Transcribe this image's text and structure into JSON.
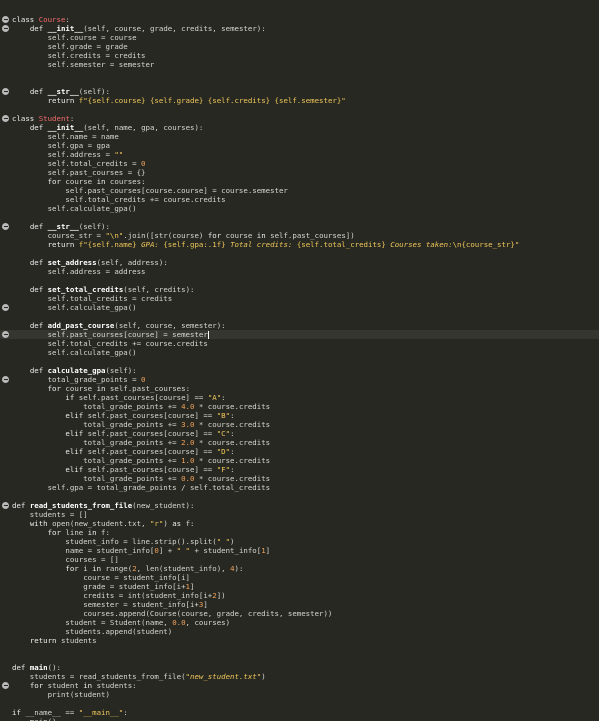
{
  "editor": {
    "cursor_line": 35,
    "fold_lines": [
      0,
      1,
      8,
      10,
      11,
      23,
      26,
      29,
      32,
      35,
      40,
      54,
      74,
      80
    ],
    "colors": {
      "background": "#272822",
      "keyword": "#eeeeee",
      "string": "#f0c85a",
      "class_name": "#f06a6a",
      "number": "#f0a15a",
      "function_name": "#ffffff",
      "text": "#d8d8d0"
    },
    "lines": [
      [
        [
          "kw",
          "class "
        ],
        [
          "cl",
          "Course"
        ],
        [
          "tx",
          ":"
        ]
      ],
      [
        [
          "tx",
          "    "
        ],
        [
          "kw",
          "def "
        ],
        [
          "fn",
          "__init__"
        ],
        [
          "tx",
          "(self, course, grade, credits, semester):"
        ]
      ],
      [
        [
          "tx",
          "        self.course = course"
        ]
      ],
      [
        [
          "tx",
          "        self.grade = grade"
        ]
      ],
      [
        [
          "tx",
          "        self.credits = credits"
        ]
      ],
      [
        [
          "tx",
          "        self.semester = semester"
        ]
      ],
      [
        [
          "tx",
          ""
        ]
      ],
      [
        [
          "tx",
          ""
        ]
      ],
      [
        [
          "tx",
          "    "
        ],
        [
          "kw",
          "def "
        ],
        [
          "fn",
          "__str__"
        ],
        [
          "tx",
          "(self):"
        ]
      ],
      [
        [
          "tx",
          "        "
        ],
        [
          "kw",
          "return "
        ],
        [
          "st",
          "f\"{self.course} {self.grade} {self.credits} {self.semester}\""
        ]
      ],
      [
        [
          "tx",
          ""
        ]
      ],
      [
        [
          "kw",
          "class "
        ],
        [
          "cl",
          "Student"
        ],
        [
          "tx",
          ":"
        ]
      ],
      [
        [
          "tx",
          "    "
        ],
        [
          "kw",
          "def "
        ],
        [
          "fn",
          "__init__"
        ],
        [
          "tx",
          "(self, name, gpa, courses):"
        ]
      ],
      [
        [
          "tx",
          "        self.name = name"
        ]
      ],
      [
        [
          "tx",
          "        self.gpa = gpa"
        ]
      ],
      [
        [
          "tx",
          "        self.address = "
        ],
        [
          "st",
          "\"\""
        ]
      ],
      [
        [
          "tx",
          "        self.total_credits = "
        ],
        [
          "nm",
          "0"
        ]
      ],
      [
        [
          "tx",
          "        self.past_courses = {}"
        ]
      ],
      [
        [
          "tx",
          "        "
        ],
        [
          "kw",
          "for"
        ],
        [
          "tx",
          " course "
        ],
        [
          "kw",
          "in"
        ],
        [
          "tx",
          " courses:"
        ]
      ],
      [
        [
          "tx",
          "            self.past_courses[course.course] = course.semester"
        ]
      ],
      [
        [
          "tx",
          "            self.total_credits += course.credits"
        ]
      ],
      [
        [
          "tx",
          "        self.calculate_gpa()"
        ]
      ],
      [
        [
          "tx",
          ""
        ]
      ],
      [
        [
          "tx",
          "    "
        ],
        [
          "kw",
          "def "
        ],
        [
          "fn",
          "__str__"
        ],
        [
          "tx",
          "(self):"
        ]
      ],
      [
        [
          "tx",
          "        course_str = "
        ],
        [
          "st",
          "\"\\n\""
        ],
        [
          "tx",
          ".join([str(course) "
        ],
        [
          "kw",
          "for"
        ],
        [
          "tx",
          " course "
        ],
        [
          "kw",
          "in"
        ],
        [
          "tx",
          " self.past_courses])"
        ]
      ],
      [
        [
          "tx",
          "        "
        ],
        [
          "kw",
          "return "
        ],
        [
          "st",
          "f\"{self.name} "
        ],
        [
          "it",
          "GPA: "
        ],
        [
          "st",
          "{self.gpa:.1f} "
        ],
        [
          "it",
          "Total credits: "
        ],
        [
          "st",
          "{self.total_credits} "
        ],
        [
          "it",
          "Courses taken:"
        ],
        [
          "st",
          "\\n{course_str}\""
        ]
      ],
      [
        [
          "tx",
          ""
        ]
      ],
      [
        [
          "tx",
          "    "
        ],
        [
          "kw",
          "def "
        ],
        [
          "fn",
          "set_address"
        ],
        [
          "tx",
          "(self, address):"
        ]
      ],
      [
        [
          "tx",
          "        self.address = address"
        ]
      ],
      [
        [
          "tx",
          ""
        ]
      ],
      [
        [
          "tx",
          "    "
        ],
        [
          "kw",
          "def "
        ],
        [
          "fn",
          "set_total_credits"
        ],
        [
          "tx",
          "(self, credits):"
        ]
      ],
      [
        [
          "tx",
          "        self.total_credits = credits"
        ]
      ],
      [
        [
          "tx",
          "        self.calculate_gpa()"
        ]
      ],
      [
        [
          "tx",
          ""
        ]
      ],
      [
        [
          "tx",
          "    "
        ],
        [
          "kw",
          "def "
        ],
        [
          "fn",
          "add_past_course"
        ],
        [
          "tx",
          "(self, course, semester):"
        ]
      ],
      [
        [
          "tx",
          "        self.past_courses[course] = semester"
        ]
      ],
      [
        [
          "tx",
          "        self.total_credits += course.credits"
        ]
      ],
      [
        [
          "tx",
          "        self.calculate_gpa()"
        ]
      ],
      [
        [
          "tx",
          ""
        ]
      ],
      [
        [
          "tx",
          "    "
        ],
        [
          "kw",
          "def "
        ],
        [
          "fn",
          "calculate_gpa"
        ],
        [
          "tx",
          "(self):"
        ]
      ],
      [
        [
          "tx",
          "        total_grade_points = "
        ],
        [
          "nm",
          "0"
        ]
      ],
      [
        [
          "tx",
          "        "
        ],
        [
          "kw",
          "for"
        ],
        [
          "tx",
          " course "
        ],
        [
          "kw",
          "in"
        ],
        [
          "tx",
          " self.past_courses:"
        ]
      ],
      [
        [
          "tx",
          "            "
        ],
        [
          "kw",
          "if"
        ],
        [
          "tx",
          " self.past_courses[course] == "
        ],
        [
          "st",
          "\"A\""
        ],
        [
          "tx",
          ":"
        ]
      ],
      [
        [
          "tx",
          "                total_grade_points += "
        ],
        [
          "nm",
          "4.0"
        ],
        [
          "tx",
          " * course.credits"
        ]
      ],
      [
        [
          "tx",
          "            "
        ],
        [
          "kw",
          "elif"
        ],
        [
          "tx",
          " self.past_courses[course] == "
        ],
        [
          "st",
          "\"B\""
        ],
        [
          "tx",
          ":"
        ]
      ],
      [
        [
          "tx",
          "                total_grade_points += "
        ],
        [
          "nm",
          "3.0"
        ],
        [
          "tx",
          " * course.credits"
        ]
      ],
      [
        [
          "tx",
          "            "
        ],
        [
          "kw",
          "elif"
        ],
        [
          "tx",
          " self.past_courses[course] == "
        ],
        [
          "st",
          "\"C\""
        ],
        [
          "tx",
          ":"
        ]
      ],
      [
        [
          "tx",
          "                total_grade_points += "
        ],
        [
          "nm",
          "2.0"
        ],
        [
          "tx",
          " * course.credits"
        ]
      ],
      [
        [
          "tx",
          "            "
        ],
        [
          "kw",
          "elif"
        ],
        [
          "tx",
          " self.past_courses[course] == "
        ],
        [
          "st",
          "\"D\""
        ],
        [
          "tx",
          ":"
        ]
      ],
      [
        [
          "tx",
          "                total_grade_points += "
        ],
        [
          "nm",
          "1.0"
        ],
        [
          "tx",
          " * course.credits"
        ]
      ],
      [
        [
          "tx",
          "            "
        ],
        [
          "kw",
          "elif"
        ],
        [
          "tx",
          " self.past_courses[course] == "
        ],
        [
          "st",
          "\"F\""
        ],
        [
          "tx",
          ":"
        ]
      ],
      [
        [
          "tx",
          "                total_grade_points += "
        ],
        [
          "nm",
          "0.0"
        ],
        [
          "tx",
          " * course.credits"
        ]
      ],
      [
        [
          "tx",
          "        self.gpa = total_grade_points / self.total_credits"
        ]
      ],
      [
        [
          "tx",
          ""
        ]
      ],
      [
        [
          "kw",
          "def "
        ],
        [
          "fn",
          "read_students_from_file"
        ],
        [
          "tx",
          "(new_student):"
        ]
      ],
      [
        [
          "tx",
          "    students = []"
        ]
      ],
      [
        [
          "tx",
          "    "
        ],
        [
          "kw",
          "with"
        ],
        [
          "tx",
          " open(new_student.txt, "
        ],
        [
          "st",
          "\"r\""
        ],
        [
          "tx",
          ") "
        ],
        [
          "kw",
          "as"
        ],
        [
          "tx",
          " f:"
        ]
      ],
      [
        [
          "tx",
          "        "
        ],
        [
          "kw",
          "for"
        ],
        [
          "tx",
          " line "
        ],
        [
          "kw",
          "in"
        ],
        [
          "tx",
          " f:"
        ]
      ],
      [
        [
          "tx",
          "            student_info = line.strip().split("
        ],
        [
          "st",
          "\" \""
        ],
        [
          "tx",
          ")"
        ]
      ],
      [
        [
          "tx",
          "            name = student_info["
        ],
        [
          "nm",
          "0"
        ],
        [
          "tx",
          "] + "
        ],
        [
          "st",
          "\" \""
        ],
        [
          "tx",
          " + student_info["
        ],
        [
          "nm",
          "1"
        ],
        [
          "tx",
          "]"
        ]
      ],
      [
        [
          "tx",
          "            courses = []"
        ]
      ],
      [
        [
          "tx",
          "            "
        ],
        [
          "kw",
          "for"
        ],
        [
          "tx",
          " i "
        ],
        [
          "kw",
          "in"
        ],
        [
          "tx",
          " range("
        ],
        [
          "nm",
          "2"
        ],
        [
          "tx",
          ", len(student_info), "
        ],
        [
          "nm",
          "4"
        ],
        [
          "tx",
          "):"
        ]
      ],
      [
        [
          "tx",
          "                course = student_info[i]"
        ]
      ],
      [
        [
          "tx",
          "                grade = student_info[i+"
        ],
        [
          "nm",
          "1"
        ],
        [
          "tx",
          "]"
        ]
      ],
      [
        [
          "tx",
          "                credits = int(student_info[i+"
        ],
        [
          "nm",
          "2"
        ],
        [
          "tx",
          "])"
        ]
      ],
      [
        [
          "tx",
          "                semester = student_info[i+"
        ],
        [
          "nm",
          "3"
        ],
        [
          "tx",
          "]"
        ]
      ],
      [
        [
          "tx",
          "                courses.append(Course(course, grade, credits, semester))"
        ]
      ],
      [
        [
          "tx",
          "            student = Student(name, "
        ],
        [
          "nm",
          "0.0"
        ],
        [
          "tx",
          ", courses)"
        ]
      ],
      [
        [
          "tx",
          "            students.append(student)"
        ]
      ],
      [
        [
          "tx",
          "    "
        ],
        [
          "kw",
          "return"
        ],
        [
          "tx",
          " students"
        ]
      ],
      [
        [
          "tx",
          ""
        ]
      ],
      [
        [
          "tx",
          ""
        ]
      ],
      [
        [
          "kw",
          "def "
        ],
        [
          "fn",
          "main"
        ],
        [
          "tx",
          "():"
        ]
      ],
      [
        [
          "tx",
          "    students = read_students_from_file("
        ],
        [
          "it",
          "\"new_student.txt\""
        ],
        [
          "tx",
          ")"
        ]
      ],
      [
        [
          "tx",
          "    "
        ],
        [
          "kw",
          "for"
        ],
        [
          "tx",
          " student "
        ],
        [
          "kw",
          "in"
        ],
        [
          "tx",
          " students:"
        ]
      ],
      [
        [
          "tx",
          "        print(student)"
        ]
      ],
      [
        [
          "tx",
          ""
        ]
      ],
      [
        [
          "kw",
          "if"
        ],
        [
          "tx",
          " __name__ == "
        ],
        [
          "st",
          "\"__main__\""
        ],
        [
          "tx",
          ":"
        ]
      ],
      [
        [
          "tx",
          "    main()"
        ]
      ]
    ]
  }
}
